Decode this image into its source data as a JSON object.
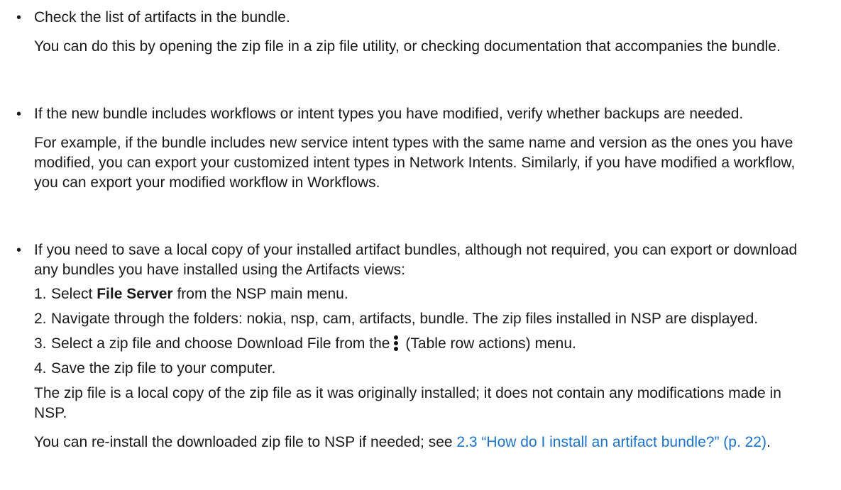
{
  "bullets": [
    {
      "marker": "•",
      "text": "Check the list of artifacts in the bundle.",
      "detail": "You can do this by opening the zip file in a zip file utility, or checking documentation that accompanies the bundle."
    },
    {
      "marker": "•",
      "text": "If the new bundle includes workflows or intent types you have modified, verify whether backups are needed.",
      "detail": "For example, if the bundle includes new service intent types with the same name and version as the ones you have modified, you can export your customized intent types in Network Intents. Similarly, if you have modified a workflow, you can export your modified workflow in Workflows."
    },
    {
      "marker": "•",
      "text": "If you need to save a local copy of your installed artifact bundles, although not required, you can export or download any bundles you have installed using the Artifacts views:",
      "steps": [
        {
          "num": "1.",
          "prefix": "Select ",
          "bold": "File Server",
          "suffix": " from the NSP main menu."
        },
        {
          "num": "2.",
          "text": "Navigate through the folders: nokia, nsp, cam, artifacts, bundle. The zip files installed in NSP are displayed."
        },
        {
          "num": "3.",
          "prefix": "Select a zip file and choose Download File from the",
          "icon": "kebab-menu-icon",
          "suffix": "(Table row actions) menu."
        },
        {
          "num": "4.",
          "text": "Save the zip file to your computer."
        }
      ],
      "after": "The zip file is a local copy of the zip file as it was originally installed; it does not contain any modifications made in NSP.",
      "last_prefix": "You can re-install the downloaded zip file to NSP if needed; see ",
      "last_link": "2.3 “How do I install an artifact bundle?” (p. 22)",
      "last_suffix": "."
    }
  ],
  "colors": {
    "text": "#1a1a1a",
    "link": "#1a73c9"
  }
}
